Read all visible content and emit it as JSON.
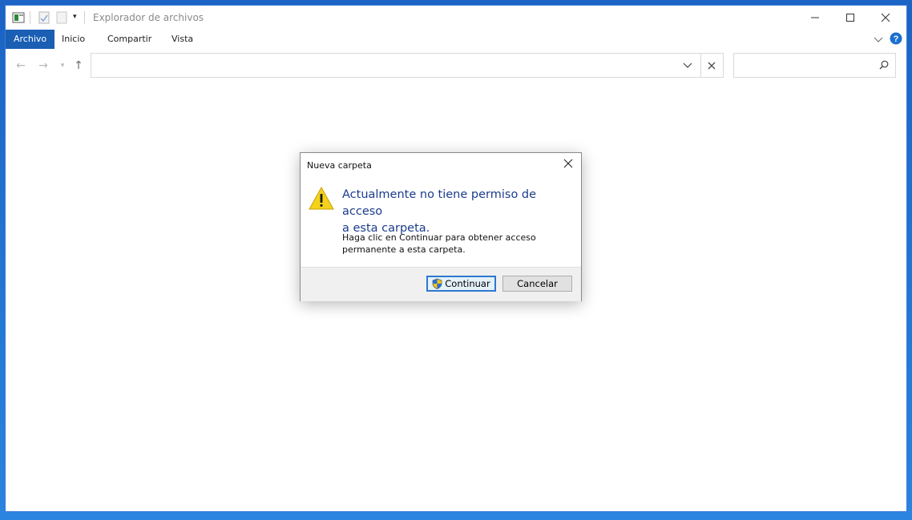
{
  "window": {
    "title": "Explorador de archivos",
    "tabs": [
      {
        "label": "Archivo",
        "active": true
      },
      {
        "label": "Inicio",
        "active": false
      },
      {
        "label": "Compartir",
        "active": false
      },
      {
        "label": "Vista",
        "active": false
      }
    ],
    "address_value": "",
    "search_value": ""
  },
  "dialog": {
    "title": "Nueva carpeta",
    "main_line1": "Actualmente no tiene permiso de acceso",
    "main_line2": "a esta carpeta.",
    "sub_line1": "Haga clic en Continuar para obtener acceso",
    "sub_line2": "permanente a esta carpeta.",
    "continue_label": "Continuar",
    "cancel_label": "Cancelar"
  },
  "colors": {
    "accent": "#1a5fb4",
    "desktop": "#1e6fd0",
    "instruction_text": "#1b3c8c"
  }
}
